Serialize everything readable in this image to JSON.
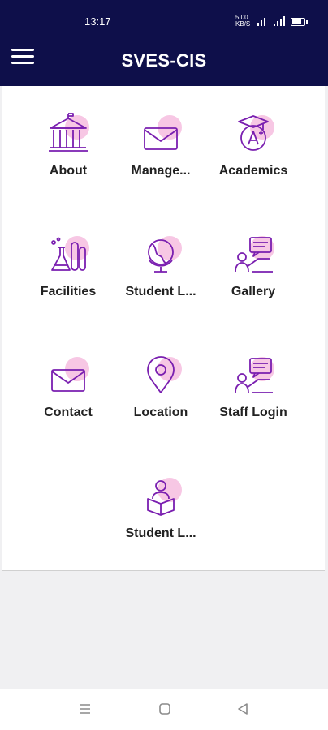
{
  "status": {
    "time": "13:17",
    "net_speed": "5.00",
    "net_unit": "KB/S"
  },
  "app": {
    "title": "SVES-CIS"
  },
  "tiles": [
    {
      "label": "About",
      "icon": "building-icon"
    },
    {
      "label": "Manage...",
      "icon": "envelope-icon"
    },
    {
      "label": "Academics",
      "icon": "grade-icon"
    },
    {
      "label": "Facilities",
      "icon": "lab-flask-icon"
    },
    {
      "label": "Student L...",
      "icon": "globe-icon"
    },
    {
      "label": "Gallery",
      "icon": "presenter-icon"
    },
    {
      "label": "Contact",
      "icon": "envelope-icon"
    },
    {
      "label": "Location",
      "icon": "map-pin-icon"
    },
    {
      "label": "Staff Login",
      "icon": "presenter-icon"
    },
    {
      "label": "Student L...",
      "icon": "student-box-icon"
    }
  ],
  "colors": {
    "header": "#0e0f4a",
    "icon_stroke": "#7a1fb0",
    "icon_blob": "#f7c7e4"
  }
}
